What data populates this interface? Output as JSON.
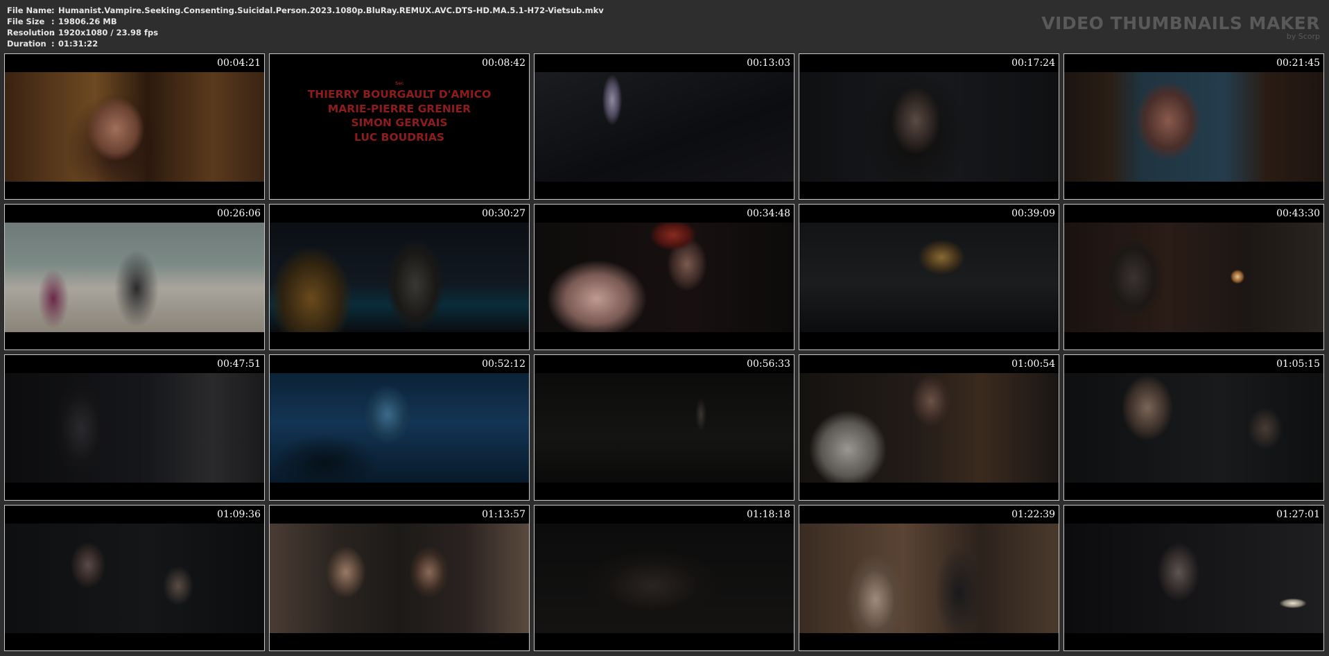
{
  "header": {
    "fields": [
      {
        "label": "File Name",
        "value": "Humanist.Vampire.Seeking.Consenting.Suicidal.Person.2023.1080p.BluRay.REMUX.AVC.DTS-HD.MA.5.1-H72-Vietsub.mkv"
      },
      {
        "label": "File Size",
        "value": "19806.26 MB"
      },
      {
        "label": "Resolution",
        "value": "1920x1080 / 23.98 fps"
      },
      {
        "label": "Duration",
        "value": "01:31:22"
      }
    ],
    "separator": ":",
    "brand_title": "VIDEO THUMBNAILS MAKER",
    "brand_sub": "by Scorp"
  },
  "credits_frame": {
    "with_label": "Sec",
    "names": [
      "THIERRY BOURGAULT D'AMICO",
      "MARIE-PIERRE GRENIER",
      "SIMON GERVAIS",
      "LUC BOUDRIAS"
    ]
  },
  "thumbnails": [
    {
      "time": "00:04:21",
      "scene": "girl-portrait-interior"
    },
    {
      "time": "00:08:42",
      "scene": "opening-credits"
    },
    {
      "time": "00:13:03",
      "scene": "figure-dark-room"
    },
    {
      "time": "00:17:24",
      "scene": "girl-closeup-dark"
    },
    {
      "time": "00:21:45",
      "scene": "painting-wall"
    },
    {
      "time": "00:26:06",
      "scene": "gymnasium"
    },
    {
      "time": "00:30:27",
      "scene": "night-parking-lot"
    },
    {
      "time": "00:34:48",
      "scene": "fur-coat-profile"
    },
    {
      "time": "00:39:09",
      "scene": "building-night"
    },
    {
      "time": "00:43:30",
      "scene": "cluttered-room"
    },
    {
      "time": "00:47:51",
      "scene": "hair-profile-dark"
    },
    {
      "time": "00:52:12",
      "scene": "blue-glass-pitcher"
    },
    {
      "time": "00:56:33",
      "scene": "dark-yard"
    },
    {
      "time": "01:00:54",
      "scene": "hoodie-two-people"
    },
    {
      "time": "01:05:15",
      "scene": "boy-closeup"
    },
    {
      "time": "01:09:36",
      "scene": "car-interior"
    },
    {
      "time": "01:13:57",
      "scene": "couple-floral-couch"
    },
    {
      "time": "01:18:18",
      "scene": "dark-closeup"
    },
    {
      "time": "01:22:39",
      "scene": "fur-woman-man"
    },
    {
      "time": "01:27:01",
      "scene": "girl-with-lamp"
    }
  ],
  "colors": {
    "background": "#2e2e2e",
    "border": "#c9c9c9",
    "credits_red": "#8e1c1c",
    "brand_text": "#595959"
  }
}
